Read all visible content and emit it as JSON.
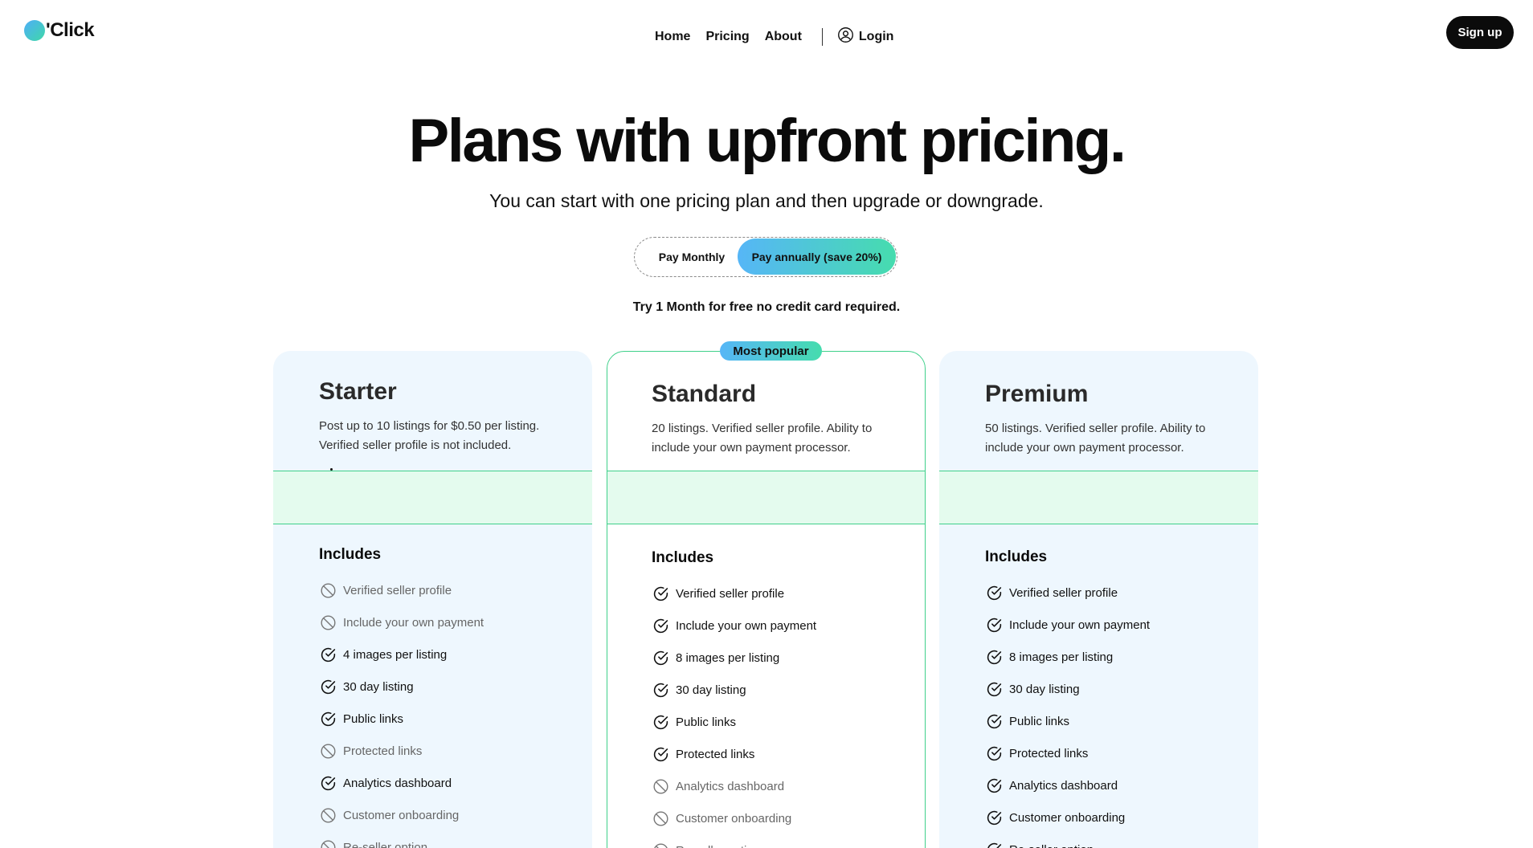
{
  "brand": {
    "name": "'Click"
  },
  "nav": {
    "links": [
      "Home",
      "Pricing",
      "About"
    ],
    "login": "Login",
    "signup": "Sign up"
  },
  "hero": {
    "title": "Plans with upfront pricing.",
    "subtitle": "You can start with one pricing plan and then upgrade or downgrade."
  },
  "billing_toggle": {
    "monthly": "Pay Monthly",
    "annual": "Pay annually (save 20%)",
    "selected": "annual"
  },
  "trial_note": "Try 1 Month for free no credit card required.",
  "colors": {
    "accent_green": "#3fd08a",
    "gradient_blue": "#56b6f7",
    "gradient_green": "#46dcae",
    "card_bg": "#eef7fe",
    "price_band_bg": "#e4fbee"
  },
  "plans": [
    {
      "name": "Starter",
      "description": "Post up to 10 listings for $0.50 per listing. Verified seller profile is not included.",
      "includes_label": "Includes",
      "features": [
        {
          "label": "Verified seller profile",
          "included": false
        },
        {
          "label": "Include your own payment",
          "included": false
        },
        {
          "label": "4 images per listing",
          "included": true
        },
        {
          "label": "30 day listing",
          "included": true
        },
        {
          "label": "Public links",
          "included": true
        },
        {
          "label": "Protected links",
          "included": false
        },
        {
          "label": "Analytics dashboard",
          "included": true
        },
        {
          "label": "Customer onboarding",
          "included": false
        },
        {
          "label": "Re-seller option",
          "included": false
        }
      ]
    },
    {
      "name": "Standard",
      "badge": "Most popular",
      "description": "20 listings. Verified seller profile. Ability to include your own payment processor.",
      "includes_label": "Includes",
      "features": [
        {
          "label": "Verified seller profile",
          "included": true
        },
        {
          "label": "Include your own payment",
          "included": true
        },
        {
          "label": "8 images per listing",
          "included": true
        },
        {
          "label": "30 day listing",
          "included": true
        },
        {
          "label": "Public links",
          "included": true
        },
        {
          "label": "Protected links",
          "included": true
        },
        {
          "label": "Analytics dashboard",
          "included": false
        },
        {
          "label": "Customer onboarding",
          "included": false
        },
        {
          "label": "Re-seller option",
          "included": false
        }
      ]
    },
    {
      "name": "Premium",
      "description": "50 listings. Verified seller profile. Ability to include your own payment processor.",
      "includes_label": "Includes",
      "features": [
        {
          "label": "Verified seller profile",
          "included": true
        },
        {
          "label": "Include your own payment",
          "included": true
        },
        {
          "label": "8 images per listing",
          "included": true
        },
        {
          "label": "30 day listing",
          "included": true
        },
        {
          "label": "Public links",
          "included": true
        },
        {
          "label": "Protected links",
          "included": true
        },
        {
          "label": "Analytics dashboard",
          "included": true
        },
        {
          "label": "Customer onboarding",
          "included": true
        },
        {
          "label": "Re-seller option",
          "included": true
        }
      ]
    }
  ]
}
